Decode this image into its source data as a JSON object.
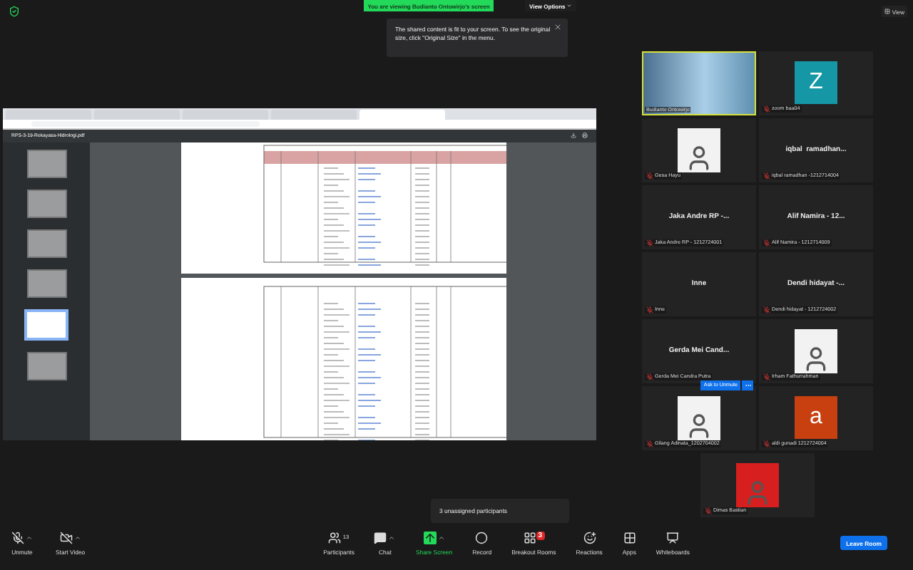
{
  "banner": {
    "text": "You are viewing Budianto Ontowirjo's screen"
  },
  "view_options": {
    "label": "View Options"
  },
  "view_button": {
    "label": "View"
  },
  "notice": {
    "text": "The shared content is fit to your screen. To see the original size, click \"Original Size\" in the menu."
  },
  "shared_screen": {
    "pdf_title": "RPS-3-19-Rekayasa-Hidrologi.pdf",
    "thumbnails": [
      {
        "selected": false
      },
      {
        "selected": false
      },
      {
        "selected": false
      },
      {
        "selected": false
      },
      {
        "selected": true
      },
      {
        "selected": false
      }
    ]
  },
  "participants": [
    {
      "kind": "video",
      "name": "Budianto Ontowirjo",
      "muted": false,
      "speaking": true
    },
    {
      "kind": "letter",
      "name": "zoom baa04",
      "letter": "Z",
      "color": "#1597a6",
      "muted": true,
      "speaking": false
    },
    {
      "kind": "photo",
      "name": "Gesa Hayu",
      "muted": true,
      "speaking": false
    },
    {
      "kind": "text",
      "display": "iqbal  ramadhan...",
      "name": "iqbal ramadhan -1212714004",
      "muted": true,
      "speaking": false
    },
    {
      "kind": "text",
      "display": "Jaka Andre RP -...",
      "name": "Jaka Andre RP - 1212724001",
      "muted": true,
      "speaking": false
    },
    {
      "kind": "text",
      "display": "Alif Namira - 12...",
      "name": "Alif Namira - 1212714009",
      "muted": true,
      "speaking": false
    },
    {
      "kind": "text",
      "display": "Inne",
      "name": "Inne",
      "muted": true,
      "speaking": false
    },
    {
      "kind": "text",
      "display": "Dendi hidayat -...",
      "name": "Dendi hidayat - 1212724002",
      "muted": true,
      "speaking": false
    },
    {
      "kind": "text",
      "display": "Gerda Mei Cand...",
      "name": "Gerda Mei Candra Putra",
      "muted": true,
      "speaking": false
    },
    {
      "kind": "photo",
      "name": "Irham Fathurrahman",
      "muted": true,
      "speaking": false
    },
    {
      "kind": "photo",
      "name": "Gilang Adinata_1202704002",
      "muted": true,
      "speaking": false,
      "overlay": "Ask to Unmute"
    },
    {
      "kind": "letter",
      "name": "aldi gunadi 1212724004",
      "letter": "a",
      "color": "#c8400f",
      "muted": true,
      "speaking": false
    },
    {
      "kind": "photo",
      "name": "Dimas Bastian",
      "muted": true,
      "speaking": false,
      "color": "#d81f1f"
    }
  ],
  "popover": {
    "text": "3 unassigned participants"
  },
  "toolbar": [
    {
      "kind": "unmute",
      "label": "Unmute",
      "caret": true
    },
    {
      "kind": "video",
      "label": "Start Video",
      "caret": true
    },
    {
      "kind": "participants",
      "label": "Participants",
      "count": "13",
      "caret": false
    },
    {
      "kind": "chat",
      "label": "Chat",
      "caret": true
    },
    {
      "kind": "share",
      "label": "Share Screen",
      "caret": true
    },
    {
      "kind": "record",
      "label": "Record",
      "caret": false
    },
    {
      "kind": "breakout",
      "label": "Breakout Rooms",
      "badge": "3",
      "caret": false
    },
    {
      "kind": "reactions",
      "label": "Reactions",
      "caret": false
    },
    {
      "kind": "apps",
      "label": "Apps",
      "caret": false
    },
    {
      "kind": "whiteboards",
      "label": "Whiteboards",
      "caret": false
    }
  ],
  "leave_button": {
    "label": "Leave Room"
  }
}
